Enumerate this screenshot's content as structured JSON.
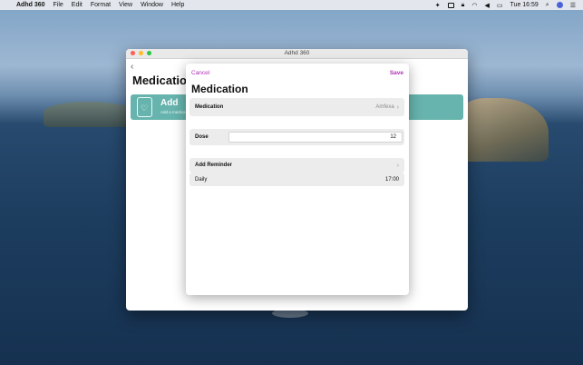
{
  "menubar": {
    "app_name": "Adhd 360",
    "menus": [
      "File",
      "Edit",
      "Format",
      "View",
      "Window",
      "Help"
    ],
    "clock": "Tue 16:59"
  },
  "window": {
    "title": "Adhd 360",
    "background_title": "Medication",
    "add_card": {
      "title": "Add",
      "subtitle": "Add a medica"
    }
  },
  "sheet": {
    "cancel_label": "Cancel",
    "save_label": "Save",
    "title": "Medication",
    "medication": {
      "label": "Medication",
      "value": "Amfexa"
    },
    "dose": {
      "label": "Dose",
      "value": "12"
    },
    "reminder": {
      "label": "Add Reminder",
      "frequency": "Daily",
      "time": "17:00"
    }
  },
  "colors": {
    "accent": "#b02fb5",
    "card": "#67b3ad"
  }
}
